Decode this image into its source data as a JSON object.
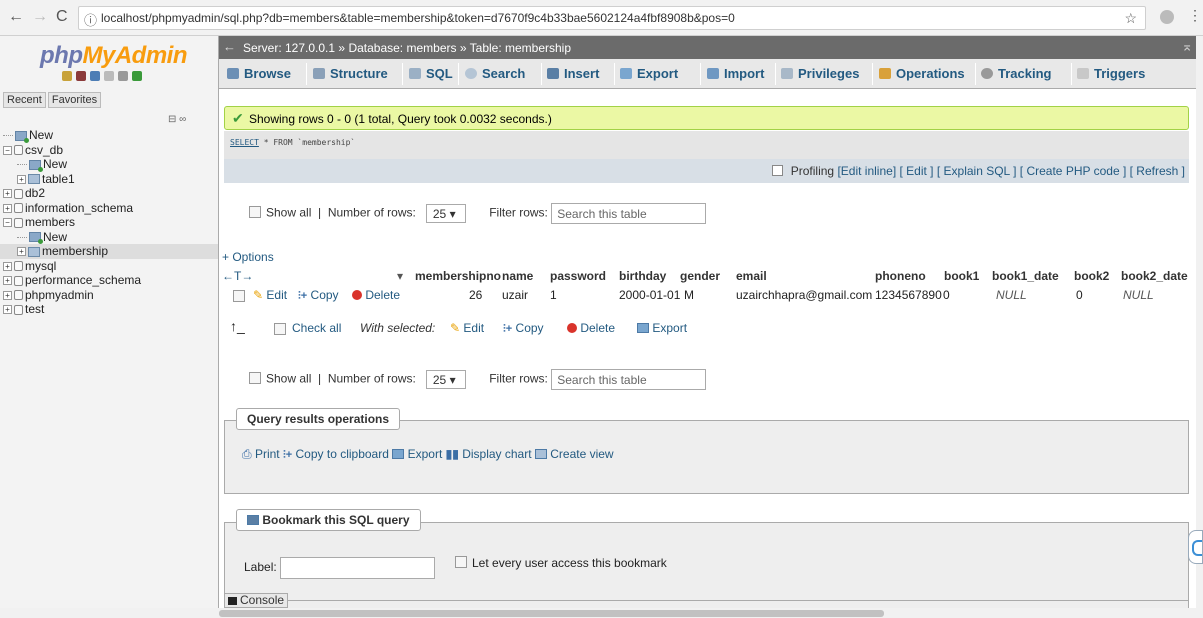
{
  "browser": {
    "url": "localhost/phpmyadmin/sql.php?db=members&table=membership&token=d7670f9c4b33bae5602124a4fbf8908b&pos=0"
  },
  "nav": {
    "logo_part1": "php",
    "logo_part2": "MyAdmin",
    "tabs": [
      "Recent",
      "Favorites"
    ],
    "tree": [
      {
        "label": "New",
        "type": "new",
        "level": 0
      },
      {
        "label": "csv_db",
        "type": "db",
        "level": 0
      },
      {
        "label": "New",
        "type": "new",
        "level": 1
      },
      {
        "label": "table1",
        "type": "table",
        "level": 1
      },
      {
        "label": "db2",
        "type": "db",
        "level": 0
      },
      {
        "label": "information_schema",
        "type": "db",
        "level": 0
      },
      {
        "label": "members",
        "type": "db",
        "level": 0
      },
      {
        "label": "New",
        "type": "new",
        "level": 1
      },
      {
        "label": "membership",
        "type": "table",
        "level": 1,
        "selected": true
      },
      {
        "label": "mysql",
        "type": "db",
        "level": 0
      },
      {
        "label": "performance_schema",
        "type": "db",
        "level": 0
      },
      {
        "label": "phpmyadmin",
        "type": "db",
        "level": 0
      },
      {
        "label": "test",
        "type": "db",
        "level": 0
      }
    ]
  },
  "breadcrumb": {
    "server": "Server: 127.0.0.1",
    "sep": "»",
    "database": "Database: members",
    "table": "Table: membership"
  },
  "menu": {
    "browse": "Browse",
    "structure": "Structure",
    "sql": "SQL",
    "search": "Search",
    "insert": "Insert",
    "export": "Export",
    "import": "Import",
    "privileges": "Privileges",
    "operations": "Operations",
    "tracking": "Tracking",
    "triggers": "Triggers"
  },
  "result": {
    "success": "Showing rows 0 - 0 (1 total, Query took 0.0032 seconds.)",
    "sql_keyword": "SELECT",
    "sql_rest": " * FROM `membership`",
    "profiling": "Profiling",
    "edit_inline": "[Edit inline]",
    "edit": "[ Edit ]",
    "explain": "[ Explain SQL ]",
    "create_php": "[ Create PHP code ]",
    "refresh": "[ Refresh ]"
  },
  "nav_controls": {
    "show_all": "Show all",
    "num_rows_label": "Number of rows:",
    "num_rows_value": "25",
    "filter_label": "Filter rows:",
    "filter_placeholder": "Search this table",
    "sep": "|"
  },
  "options_link": "+ Options",
  "sort_arrows": "←T→",
  "table": {
    "columns": [
      "membershipno",
      "name",
      "password",
      "birthday",
      "gender",
      "email",
      "phoneno",
      "book1",
      "book1_date",
      "book2",
      "book2_date"
    ],
    "row": {
      "edit": "Edit",
      "copy": "Copy",
      "delete": "Delete",
      "membershipno": "26",
      "name": "uzair",
      "password": "1",
      "birthday": "2000-01-01",
      "gender": "M",
      "email": "uzairchhapra@gmail.com",
      "phoneno": "1234567890",
      "book1": "0",
      "book1_date": "NULL",
      "book2": "0",
      "book2_date": "NULL"
    }
  },
  "bulk": {
    "check_all": "Check all",
    "with_selected": "With selected:",
    "edit": "Edit",
    "copy": "Copy",
    "delete": "Delete",
    "export": "Export"
  },
  "query_ops": {
    "legend": "Query results operations",
    "print": "Print",
    "copy_clipboard": "Copy to clipboard",
    "export": "Export",
    "display_chart": "Display chart",
    "create_view": "Create view"
  },
  "bookmark": {
    "legend": "Bookmark this SQL query",
    "label": "Label:",
    "share": "Let every user access this bookmark"
  },
  "console": "Console"
}
